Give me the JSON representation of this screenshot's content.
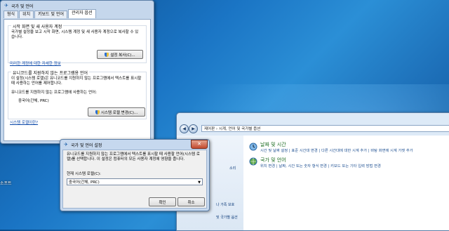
{
  "desktop": {
    "label": "소프트"
  },
  "region_window": {
    "title": "국가 및 언어",
    "tabs": [
      "형식",
      "위치",
      "키보드 및 언어",
      "관리자 옵션"
    ],
    "welcome_group": {
      "title": "시작 화면 및 새 사용자 계정",
      "text": "국가별 설정을 보고 시작 화면, 시스템 계정 및 새 사용자 계정으로 복사할 수 있습니다.",
      "copy_button": "설정 복사(C)..."
    },
    "welcome_link": "미리한 계정에 대한 자세한 정보",
    "nonunicode_group": {
      "title": "유니코드를 지원하지 않는 프로그램용 언어",
      "text": "이 설정(시스템 로캘)은 유니코드를 지원하지 않는 프로그램에서 텍스트를 표시할 때 사용하는 언어를 제어합니다.",
      "current_label": "유니코드를 지원하지 않는 프로그램에 사용하는 언어:",
      "current_value": "중국어(간체, PRC)",
      "change_button": "시스템 로캘 변경(C)..."
    },
    "locale_link": "시스템 로캘이란?"
  },
  "control_panel": {
    "address": "제어판  ›  시계, 언어 및 국가별 옵션",
    "sidebar": [
      "소리",
      "나 가족 보호",
      "및 국가별 옵션"
    ],
    "categories": [
      {
        "title": "날짜 및 시간",
        "links": "시간 및 날짜 설정  |  표준 시간대 변경  |  다른 시간대에 대한 시계 추가  |  바탕 화면에 시계 가젯 추가"
      },
      {
        "title": "국가 및 언어",
        "links": "위치 변경  |  날짜, 시간 또는 숫자 형식 변경  |  키보드 또는 기타 입력 방법 변경"
      }
    ]
  },
  "dialog": {
    "title": "국가 및 언어 설정",
    "text": "유니코드를 지원하지 않는 프로그램에서 텍스트를 표시할 때 사용할 언어(시스템 로캘)를 선택합니다. 이 설정은 컴퓨터의 모든 사용자 계정에 영향을 줍니다.",
    "select_label": "현재 시스템 로캘(C):",
    "select_value": "중국어(간체, PRC)",
    "ok_button": "확인",
    "cancel_button": "취소",
    "close_glyph": "✕"
  },
  "colors": {
    "desktop": "#1a74c4",
    "link": "#0a47a8",
    "category_title": "#1a6b1f"
  }
}
